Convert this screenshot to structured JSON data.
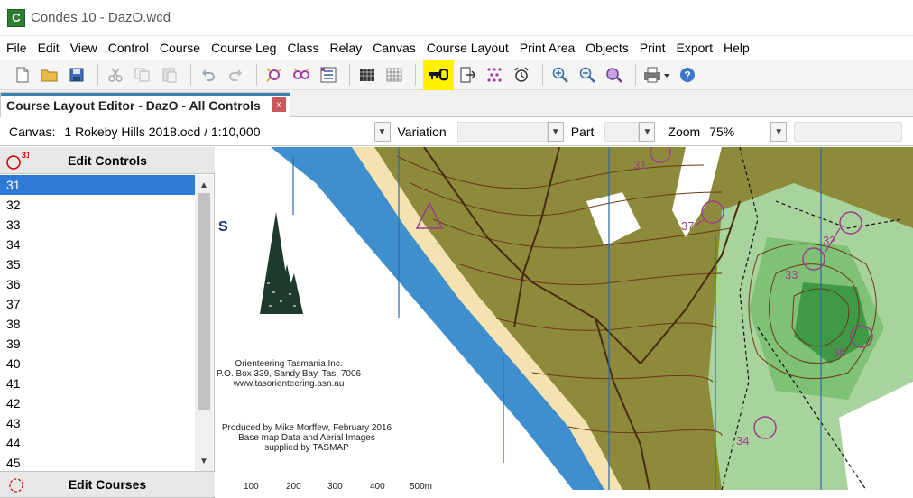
{
  "window": {
    "title": "Condes 10 - DazO.wcd",
    "app_icon_letter": "C"
  },
  "menu": [
    "File",
    "Edit",
    "View",
    "Control",
    "Course",
    "Course Leg",
    "Class",
    "Relay",
    "Canvas",
    "Course Layout",
    "Print Area",
    "Objects",
    "Print",
    "Export",
    "Help"
  ],
  "toolbar": {
    "icons": [
      "new-icon",
      "open-icon",
      "save-icon",
      "cut-icon",
      "copy-icon",
      "paste-icon",
      "undo-icon",
      "redo-icon",
      "magic-control-icon",
      "magic-course-icon",
      "course-list-icon",
      "grid-icon",
      "grid-lines-icon",
      "key-icon",
      "exit-icon",
      "scatter-icon",
      "alarm-icon",
      "zoom-in-icon",
      "zoom-out-icon",
      "zoom-fit-icon",
      "print-icon",
      "help-icon"
    ],
    "highlight_color": "#fff200"
  },
  "tab": {
    "label": "Course Layout Editor - DazO - All Controls",
    "close": "x"
  },
  "canvasbar": {
    "canvas_label": "Canvas:",
    "canvas_value": "1 Rokeby Hills 2018.ocd  / 1:10,000",
    "variation_label": "Variation",
    "part_label": "Part",
    "zoom_label": "Zoom",
    "zoom_value": "75%"
  },
  "panel": {
    "controls_header": "Edit Controls",
    "controls_icon_badge": "31",
    "controls": [
      "31",
      "32",
      "33",
      "34",
      "35",
      "36",
      "37",
      "38",
      "39",
      "40",
      "41",
      "42",
      "43",
      "44",
      "45"
    ],
    "selected_control": "31",
    "courses_header": "Edit Courses"
  },
  "map": {
    "credits": [
      "Orienteering Tasmania Inc.",
      "P.O. Box 339, Sandy Bay, Tas. 7006",
      "www.tasorienteering.asn.au"
    ],
    "produced": [
      "Produced by Mike Morffew, February 2016",
      "Base map Data and Aerial Images",
      "supplied by TASMAP"
    ],
    "scale_labels": [
      "100",
      "200",
      "300",
      "400",
      "500m"
    ],
    "start_label": "S",
    "control_labels": [
      "31",
      "32",
      "33",
      "34",
      "36",
      "37"
    ],
    "colors": {
      "water": "#3f8fcf",
      "olive": "#8e8a3c",
      "green": "#6fb86a",
      "course": "#9b3f8a"
    }
  }
}
